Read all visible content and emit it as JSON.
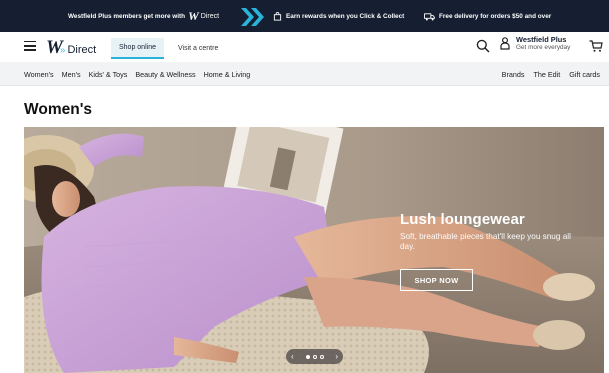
{
  "promo": {
    "members_text": "Westfield Plus members get more with",
    "logo_w": "W",
    "logo_direct": "Direct",
    "rewards_text": "Earn rewards when you Click & Collect",
    "delivery_text": "Free delivery for orders $50 and over"
  },
  "header": {
    "logo_w": "W",
    "logo_direct": "Direct",
    "shop_online": "Shop online",
    "visit_centre": "Visit a centre",
    "plus_title": "Westfield Plus",
    "plus_sub": "Get more everyday"
  },
  "nav": {
    "left": [
      "Women's",
      "Men's",
      "Kids' & Toys",
      "Beauty & Wellness",
      "Home & Living"
    ],
    "right": [
      "Brands",
      "The Edit",
      "Gift cards"
    ]
  },
  "page": {
    "title": "Women's"
  },
  "hero": {
    "headline": "Lush loungewear",
    "subtext": "Soft, breathable pieces that'll keep you snug all day.",
    "cta": "SHOP NOW",
    "prev": "‹",
    "next": "›",
    "slides_total": 3,
    "active_slide": 1
  },
  "colors": {
    "promo_bg": "#151f31",
    "accent": "#2ab3d9",
    "nav_bg": "#f2f3f4"
  }
}
